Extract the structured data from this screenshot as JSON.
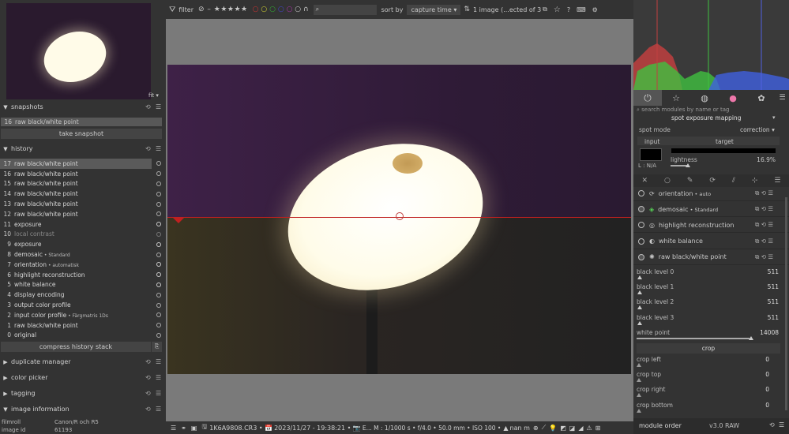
{
  "left": {
    "fit_label": "fit",
    "snapshots": {
      "title": "snapshots",
      "item_num": "16",
      "item_label": "raw black/white point",
      "take_label": "take snapshot"
    },
    "history": {
      "title": "history",
      "items": [
        {
          "n": "17",
          "label": "raw black/white point",
          "sub": ""
        },
        {
          "n": "16",
          "label": "raw black/white point",
          "sub": ""
        },
        {
          "n": "15",
          "label": "raw black/white point",
          "sub": ""
        },
        {
          "n": "14",
          "label": "raw black/white point",
          "sub": ""
        },
        {
          "n": "13",
          "label": "raw black/white point",
          "sub": ""
        },
        {
          "n": "12",
          "label": "raw black/white point",
          "sub": ""
        },
        {
          "n": "11",
          "label": "exposure",
          "sub": ""
        },
        {
          "n": "10",
          "label": "local contrast",
          "sub": ""
        },
        {
          "n": "9",
          "label": "exposure",
          "sub": ""
        },
        {
          "n": "8",
          "label": "demosaic",
          "sub": " • Standard"
        },
        {
          "n": "7",
          "label": "orientation",
          "sub": " • automatisk"
        },
        {
          "n": "6",
          "label": "highlight reconstruction",
          "sub": ""
        },
        {
          "n": "5",
          "label": "white balance",
          "sub": ""
        },
        {
          "n": "4",
          "label": "display encoding",
          "sub": ""
        },
        {
          "n": "3",
          "label": "output color profile",
          "sub": ""
        },
        {
          "n": "2",
          "label": "input color profile",
          "sub": " • Färgmatris 1Ds"
        },
        {
          "n": "1",
          "label": "raw black/white point",
          "sub": ""
        },
        {
          "n": "0",
          "label": "original",
          "sub": ""
        }
      ],
      "compress_label": "compress history stack"
    },
    "duplicate_manager": "duplicate manager",
    "color_picker": "color picker",
    "tagging": "tagging",
    "image_information": {
      "title": "image information",
      "rows": [
        [
          "filmroll",
          "Canon/R och R5"
        ],
        [
          "image id",
          "61193"
        ]
      ]
    }
  },
  "toolbar": {
    "filter": "filter",
    "sort_by": "sort by",
    "sort_value": "capture time",
    "count": "1 image (...ected of 3"
  },
  "bottombar": {
    "filename": "1K6A9808.CR3",
    "sep": " • ",
    "datetime": "2023/11/27 - 19:38:21",
    "exif": "E... M : 1/1000 s • f/4.0 • 50.0 mm • ISO 100 •",
    "lens": "nan m"
  },
  "right": {
    "search_placeholder": "search modules by name or tag",
    "spot": {
      "title": "spot exposure mapping",
      "mode_label": "spot mode",
      "mode_value": "correction",
      "input": "input",
      "target": "target",
      "lightness_label": "lightness",
      "lightness_value": "16.9%",
      "lightness_fraction": 0.169,
      "l_label": "L : N/A"
    },
    "modules": [
      {
        "name": "orientation",
        "sub": " • auto"
      },
      {
        "name": "demosaic",
        "sub": " • Standard"
      },
      {
        "name": "highlight reconstruction",
        "sub": ""
      },
      {
        "name": "white balance",
        "sub": ""
      },
      {
        "name": "raw black/white point",
        "sub": ""
      }
    ],
    "sliders": [
      {
        "label": "black level 0",
        "value": "511"
      },
      {
        "label": "black level 1",
        "value": "511"
      },
      {
        "label": "black level 2",
        "value": "511"
      },
      {
        "label": "black level 3",
        "value": "511"
      },
      {
        "label": "white point",
        "value": "14008"
      }
    ],
    "crop_title": "crop",
    "crop": [
      {
        "label": "crop left",
        "value": "0"
      },
      {
        "label": "crop top",
        "value": "0"
      },
      {
        "label": "crop right",
        "value": "0"
      },
      {
        "label": "crop bottom",
        "value": "0"
      }
    ],
    "module_order": "module order",
    "version": "v3.0 RAW"
  }
}
